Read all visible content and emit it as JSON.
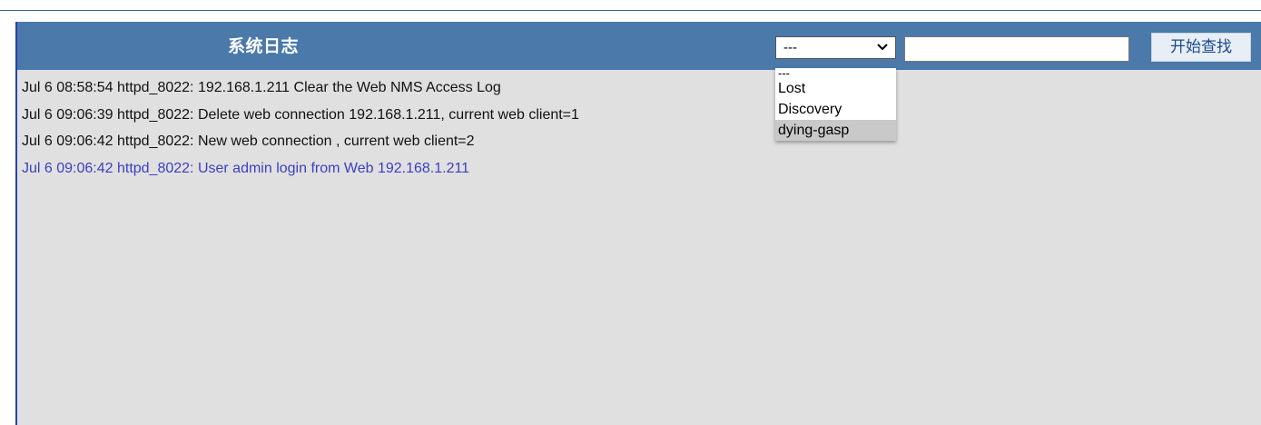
{
  "header": {
    "title": "系统日志",
    "filter_select": {
      "selected": "---",
      "options": [
        "---",
        "Lost",
        "Discovery",
        "dying-gasp"
      ],
      "highlighted": "dying-gasp"
    },
    "search_input": {
      "value": "",
      "placeholder": ""
    },
    "search_button_label": "开始查找"
  },
  "logs": [
    "Jul 6 08:58:54 httpd_8022: 192.168.1.211 Clear the Web NMS Access Log",
    "Jul 6 09:06:39 httpd_8022: Delete web connection 192.168.1.211, current web client=1",
    "Jul 6 09:06:42 httpd_8022: New web connection , current web client=2",
    "Jul 6 09:06:42 httpd_8022: User admin login from Web 192.168.1.211"
  ],
  "colors": {
    "header_bg": "#4a79aa",
    "panel_bg": "#e0e0e0",
    "highlight_log": "#3b3fbf"
  }
}
